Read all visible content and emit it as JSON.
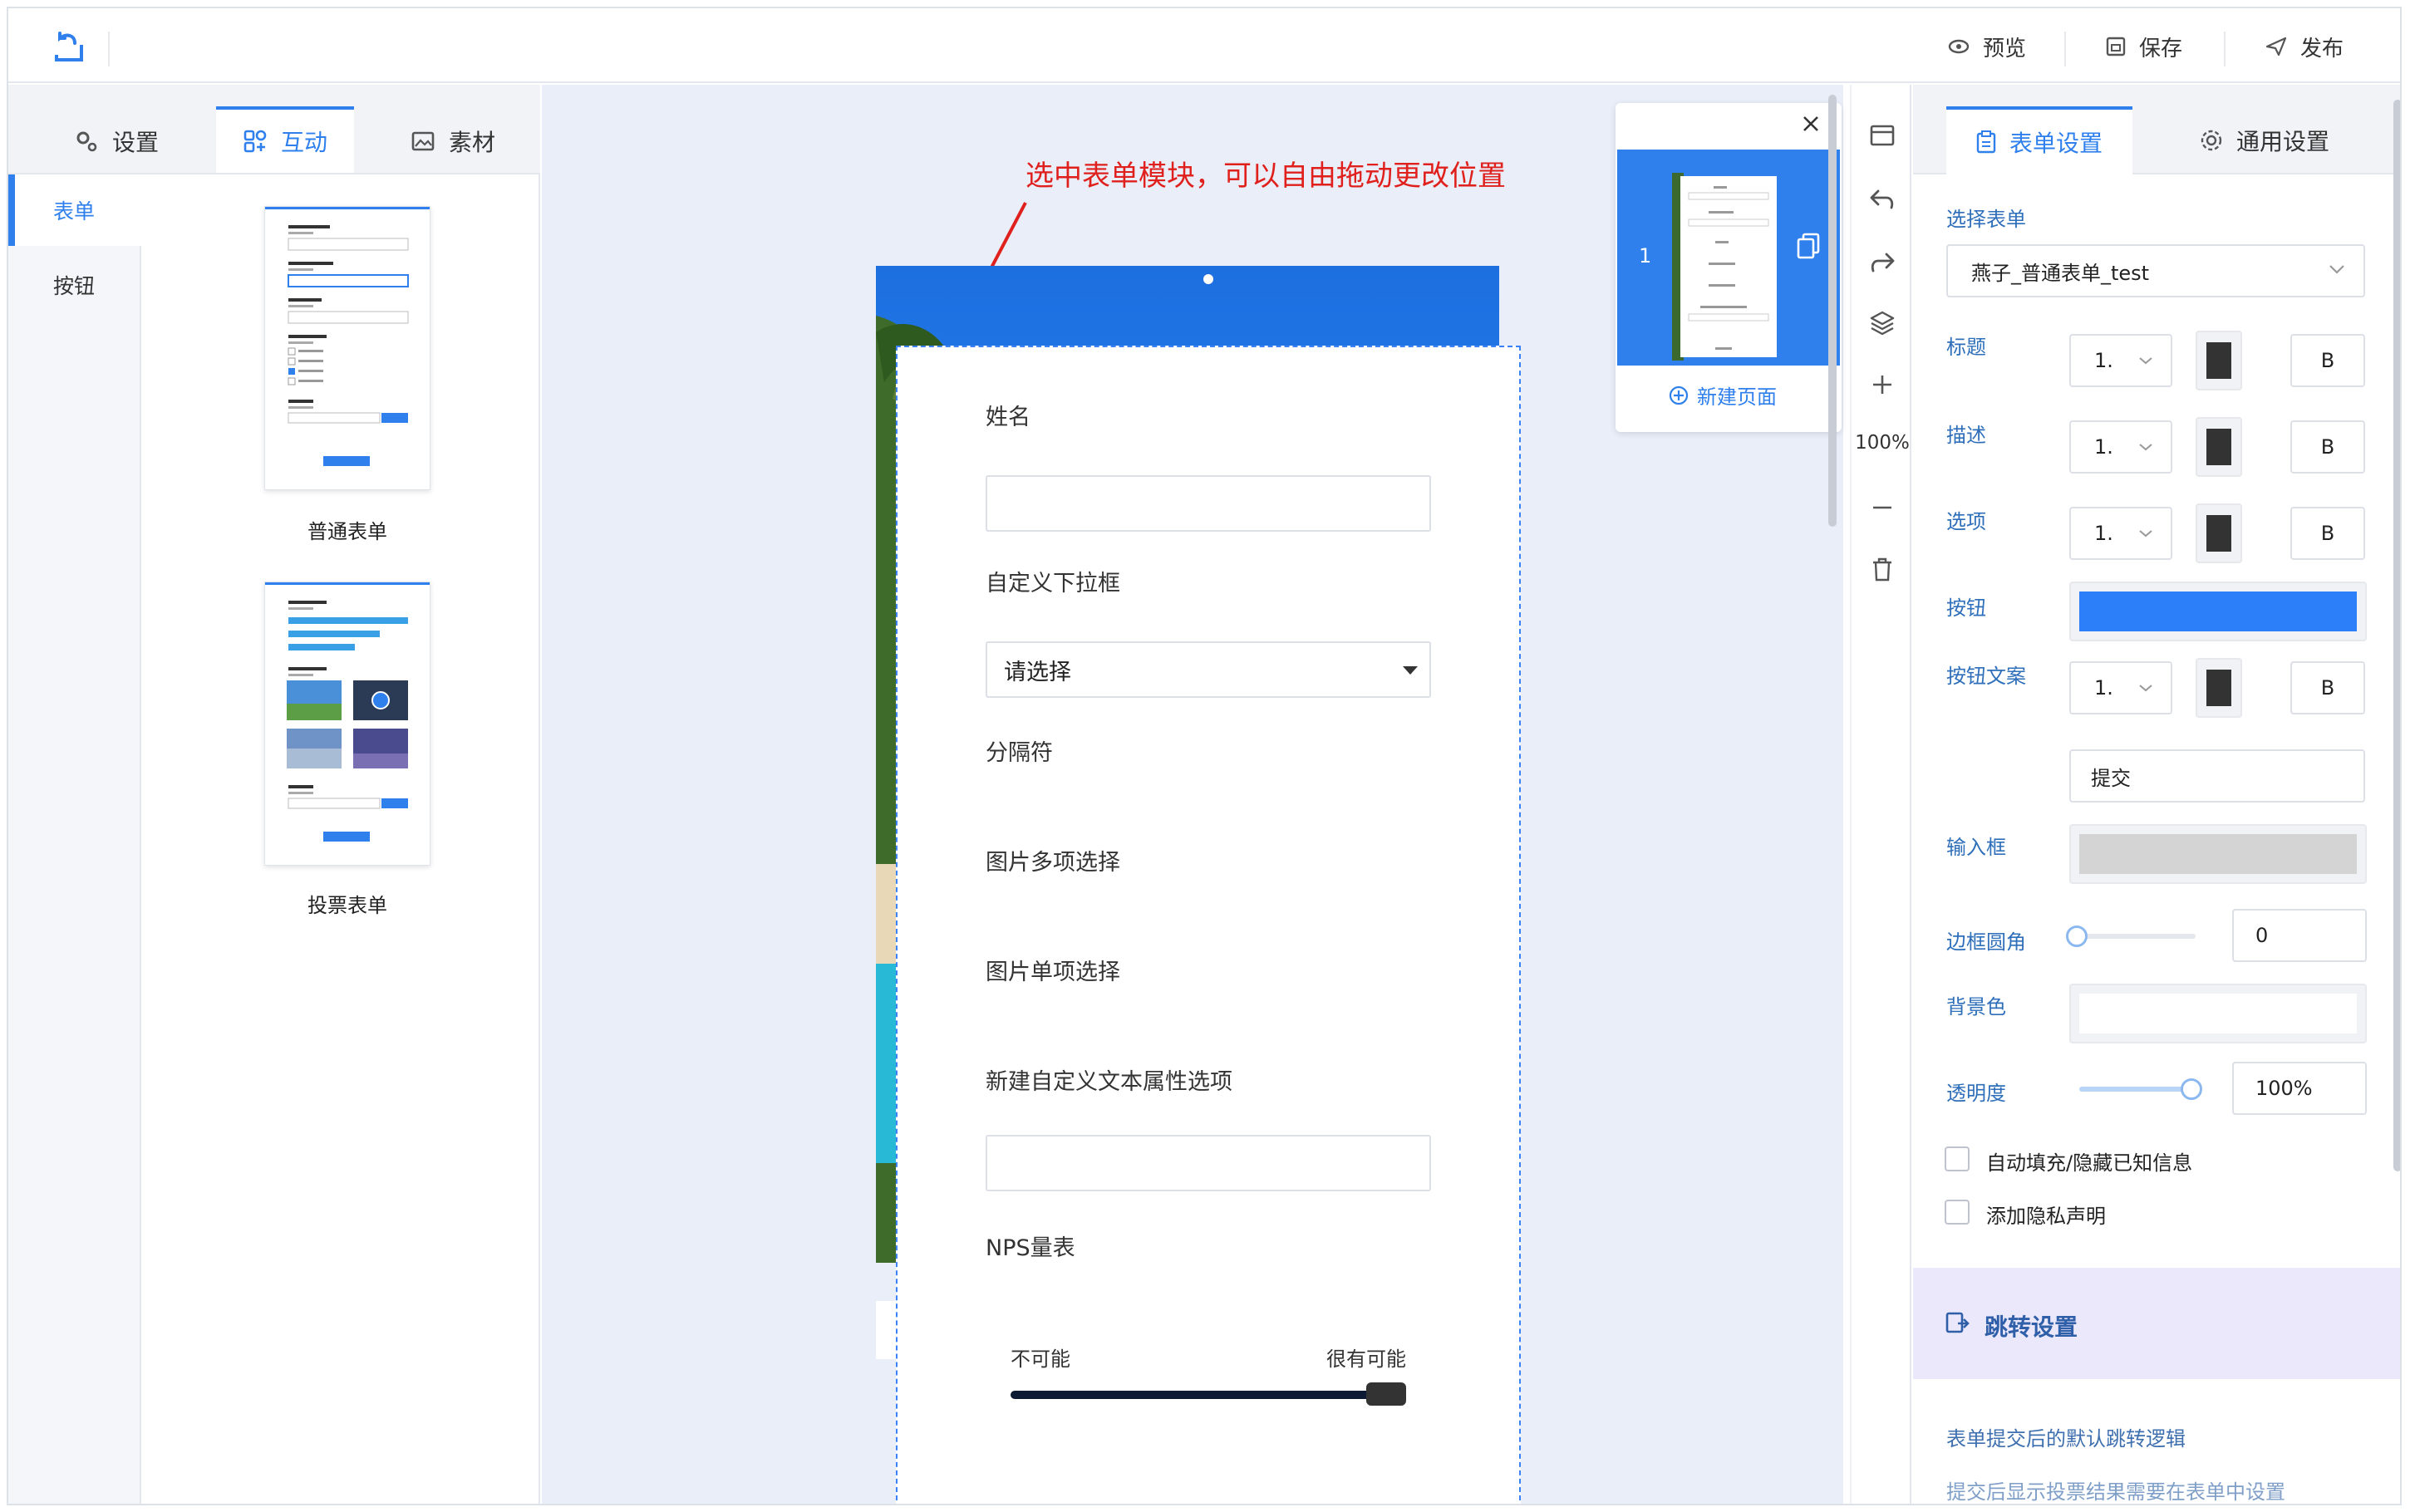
{
  "topbar": {
    "preview_label": "预览",
    "save_label": "保存",
    "publish_label": "发布"
  },
  "left_panel": {
    "tabs": [
      {
        "label": "设置",
        "icon": "gear-icon"
      },
      {
        "label": "互动",
        "icon": "interaction-icon",
        "active": true
      },
      {
        "label": "素材",
        "icon": "image-icon"
      }
    ],
    "side_items": [
      {
        "label": "表单",
        "active": true
      },
      {
        "label": "按钮"
      }
    ],
    "templates": [
      {
        "label": "普通表单"
      },
      {
        "label": "投票表单"
      }
    ]
  },
  "canvas": {
    "annotation": "选中表单模块，可以自由拖动更改位置",
    "form": {
      "name_label": "姓名",
      "dropdown_label": "自定义下拉框",
      "dropdown_value": "请选择",
      "separator_label": "分隔符",
      "image_multi_label": "图片多项选择",
      "image_single_label": "图片单项选择",
      "custom_text_label": "新建自定义文本属性选项",
      "nps_label": "NPS量表",
      "nps_low": "不可能",
      "nps_high": "很有可能",
      "nps_value": 1.0
    }
  },
  "page_panel": {
    "page_number": "1",
    "new_page_label": "新建页面"
  },
  "toolbar": {
    "zoom": "100%"
  },
  "right_panel": {
    "tabs": [
      {
        "label": "表单设置",
        "active": true
      },
      {
        "label": "通用设置"
      }
    ],
    "select_form_label": "选择表单",
    "selected_form": "燕子_普通表单_test",
    "rows": {
      "title": {
        "label": "标题",
        "size": "1.",
        "bold": "B"
      },
      "desc": {
        "label": "描述",
        "size": "1.",
        "bold": "B"
      },
      "option": {
        "label": "选项",
        "size": "1.",
        "bold": "B"
      },
      "button": {
        "label": "按钮"
      },
      "button_text": {
        "label": "按钮文案",
        "size": "1.",
        "bold": "B",
        "value": "提交"
      },
      "input": {
        "label": "输入框"
      },
      "radius": {
        "label": "边框圆角",
        "value": "0"
      },
      "bg": {
        "label": "背景色"
      },
      "opacity": {
        "label": "透明度",
        "value": "100%"
      }
    },
    "checkboxes": [
      {
        "label": "自动填充/隐藏已知信息",
        "checked": false
      },
      {
        "label": "添加隐私声明",
        "checked": false
      }
    ],
    "jump_title": "跳转设置",
    "jump_desc": "表单提交后的默认跳转逻辑",
    "jump_note": "提交后显示投票结果需要在表单中设置"
  },
  "colors": {
    "accent": "#2f80ed",
    "button_color": "#2d7ff9",
    "annotation": "#e0201c"
  }
}
